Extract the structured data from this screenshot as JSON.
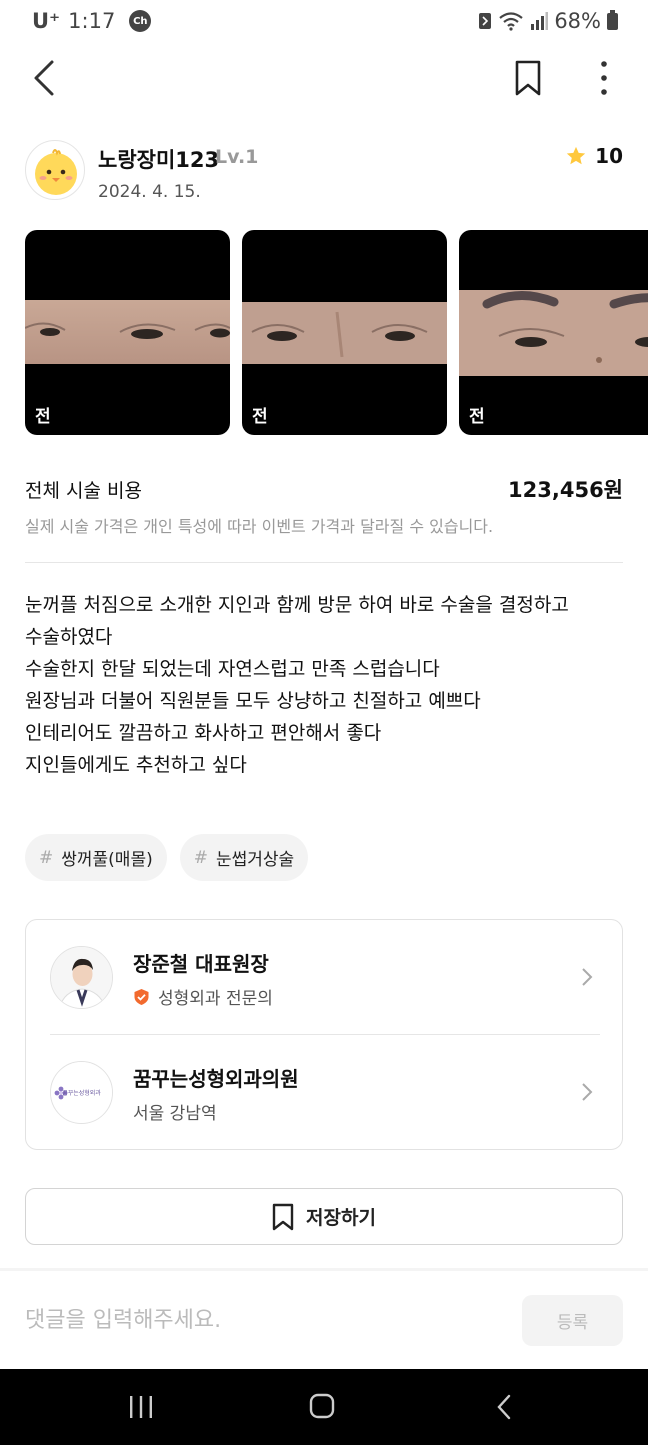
{
  "status_bar": {
    "carrier": "U⁺",
    "time": "1:17",
    "notification_badge": "Ch",
    "battery": "68%"
  },
  "post": {
    "username": "노랑장미123",
    "level": "Lv.1",
    "date": "2024. 4. 15.",
    "rating": "10",
    "photos": [
      {
        "tag": "전"
      },
      {
        "tag": "전"
      },
      {
        "tag": "전"
      }
    ],
    "cost_label": "전체 시술 비용",
    "cost_value": "123,456원",
    "cost_note": "실제 시술 가격은 개인 특성에 따라 이벤트 가격과 달라질 수 있습니다.",
    "review_lines": [
      "눈꺼플 처짐으로 소개한 지인과 함께 방문 하여 바로 수술을 결정하고",
      "수술하였다",
      "수술한지 한달 되었는데 자연스럽고 만족 스럽습니다",
      "원장님과 더불어 직원분들 모두 상냥하고  친절하고 예쁘다",
      "인테리어도 깔끔하고 화사하고 편안해서 좋다",
      "지인들에게도 추천하고 싶다"
    ],
    "tags": [
      "쌍꺼풀(매몰)",
      "눈썹거상술"
    ],
    "tag_hash": "#"
  },
  "doctor_card": {
    "doctor_name": "장준철 대표원장",
    "doctor_specialty": "성형외과 전문의",
    "clinic_name": "꿈꾸는성형외과의원",
    "clinic_location": "서울 강남역",
    "clinic_logo_text": "꿈꾸는성형외과"
  },
  "actions": {
    "save_label": "저장하기",
    "comment_placeholder": "댓글을 입력해주세요.",
    "submit_label": "등록"
  },
  "icons": {
    "back": "back-arrow-icon",
    "bookmark": "bookmark-icon",
    "more": "more-vertical-icon",
    "star": "star-icon",
    "verified": "verified-badge-icon",
    "chevron": "chevron-right-icon"
  },
  "colors": {
    "star": "#FFC83D",
    "verified_badge": "#F26A2E",
    "muted_text": "#999999",
    "nav_bar": "#000000"
  }
}
